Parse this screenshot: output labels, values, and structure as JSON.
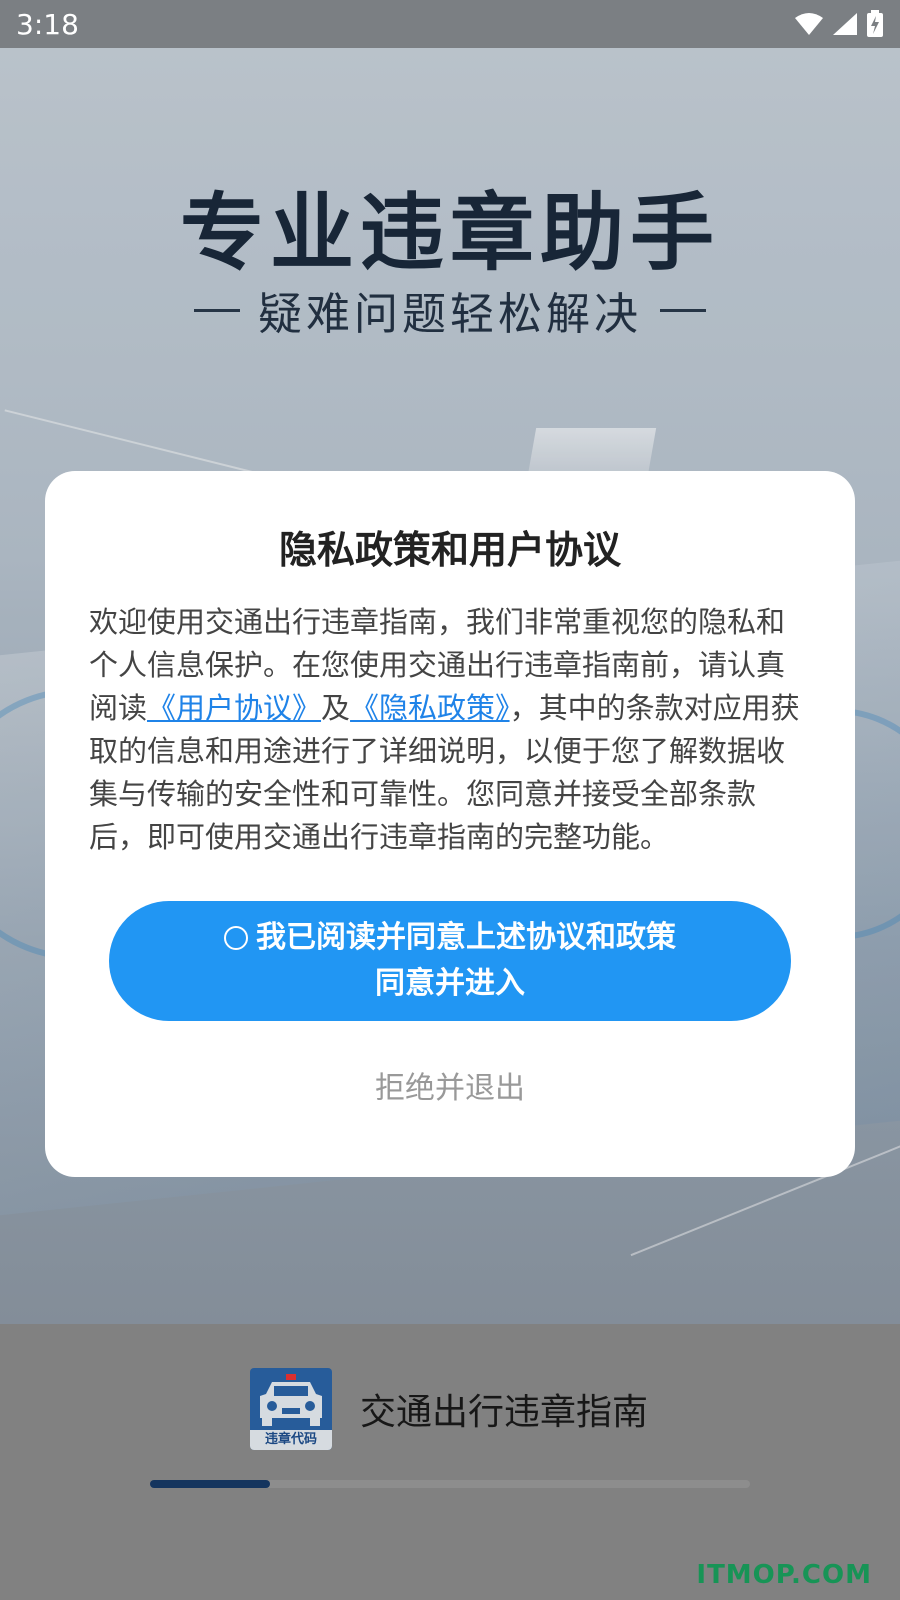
{
  "status_bar": {
    "time": "3:18",
    "icons": [
      "wifi-icon",
      "signal-icon",
      "battery-charging-icon"
    ]
  },
  "splash": {
    "title": "专业违章助手",
    "subtitle": "疑难问题轻松解决"
  },
  "dialog": {
    "title": "隐私政策和用户协议",
    "body_part1": "欢迎使用交通出行违章指南，我们非常重视您的隐私和个人信息保护。在您使用交通出行违章指南前，请认真阅读",
    "link_user_agreement": "《用户协议》",
    "body_and": "及",
    "link_privacy_policy": "《隐私政策》",
    "body_part2": "，其中的条款对应用获取的信息和用途进行了详细说明，以便于您了解数据收集与传输的安全性和可靠性。您同意并接受全部条款后，即可使用交通出行违章指南的完整功能。",
    "agree_checkbox_label": "我已阅读并同意上述协议和政策",
    "agree_button_label": "同意并进入",
    "reject_button_label": "拒绝并退出"
  },
  "brand": {
    "logo_caption": "违章代码",
    "app_name": "交通出行违章指南",
    "loading_progress": 0.2
  },
  "watermark": "ITMOP.COM",
  "colors": {
    "primary": "#2196f3",
    "link": "#1f83e8",
    "progress": "#173a66",
    "watermark": "#1aa15e"
  }
}
